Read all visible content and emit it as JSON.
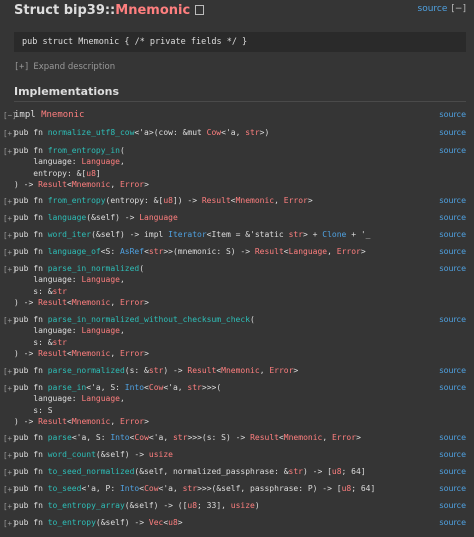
{
  "header": {
    "prefix": "Struct ",
    "crate": "bip39::",
    "name": "Mnemonic"
  },
  "top_source": {
    "label": "source",
    "collapse": "[−]"
  },
  "declaration": "pub struct Mnemonic { /* private fields */ }",
  "expand": {
    "toggle": "[+]",
    "label": "Expand description"
  },
  "implementations_heading": "Implementations",
  "source_label": "source",
  "items": [
    {
      "id": "impl",
      "toggle": "[−]",
      "lines": [
        [
          [
            "impl ",
            "p"
          ],
          [
            "Mnemonic",
            "ty"
          ]
        ]
      ]
    },
    {
      "id": "normalize_utf8_cow",
      "toggle": "[+]",
      "lines": [
        [
          [
            "pub fn ",
            "p"
          ],
          [
            "normalize_utf8_cow",
            "fn"
          ],
          [
            "<'a>(cow: &mut ",
            "p"
          ],
          [
            "Cow",
            "ty"
          ],
          [
            "<'a, ",
            "p"
          ],
          [
            "str",
            "ty"
          ],
          [
            ">)",
            "p"
          ]
        ]
      ]
    },
    {
      "id": "from_entropy_in",
      "toggle": "[+]",
      "lines": [
        [
          [
            "pub fn ",
            "p"
          ],
          [
            "from_entropy_in",
            "fn"
          ],
          [
            "(",
            "p"
          ]
        ],
        [
          [
            "    language: ",
            "p"
          ],
          [
            "Language",
            "ty"
          ],
          [
            ",",
            "p"
          ]
        ],
        [
          [
            "    entropy: &[",
            "p"
          ],
          [
            "u8",
            "ty"
          ],
          [
            "]",
            "p"
          ]
        ],
        [
          [
            ") -> ",
            "p"
          ],
          [
            "Result",
            "ty"
          ],
          [
            "<",
            "p"
          ],
          [
            "Mnemonic",
            "ty"
          ],
          [
            ", ",
            "p"
          ],
          [
            "Error",
            "ty"
          ],
          [
            ">",
            "p"
          ]
        ]
      ]
    },
    {
      "id": "from_entropy",
      "toggle": "[+]",
      "lines": [
        [
          [
            "pub fn ",
            "p"
          ],
          [
            "from_entropy",
            "fn"
          ],
          [
            "(entropy: &[",
            "p"
          ],
          [
            "u8",
            "ty"
          ],
          [
            "]) -> ",
            "p"
          ],
          [
            "Result",
            "ty"
          ],
          [
            "<",
            "p"
          ],
          [
            "Mnemonic",
            "ty"
          ],
          [
            ", ",
            "p"
          ],
          [
            "Error",
            "ty"
          ],
          [
            ">",
            "p"
          ]
        ]
      ]
    },
    {
      "id": "language",
      "toggle": "[+]",
      "lines": [
        [
          [
            "pub fn ",
            "p"
          ],
          [
            "language",
            "fn"
          ],
          [
            "(&self) -> ",
            "p"
          ],
          [
            "Language",
            "ty"
          ]
        ]
      ]
    },
    {
      "id": "word_iter",
      "toggle": "[+]",
      "lines": [
        [
          [
            "pub fn ",
            "p"
          ],
          [
            "word_iter",
            "fn"
          ],
          [
            "(&self) -> impl ",
            "p"
          ],
          [
            "Iterator",
            "tr"
          ],
          [
            "<Item = &'static ",
            "p"
          ],
          [
            "str",
            "ty"
          ],
          [
            "> + ",
            "p"
          ],
          [
            "Clone",
            "tr"
          ],
          [
            " + '_",
            "p"
          ]
        ]
      ]
    },
    {
      "id": "language_of",
      "toggle": "[+]",
      "lines": [
        [
          [
            "pub fn ",
            "p"
          ],
          [
            "language_of",
            "fn"
          ],
          [
            "<S: ",
            "p"
          ],
          [
            "AsRef",
            "tr"
          ],
          [
            "<",
            "p"
          ],
          [
            "str",
            "ty"
          ],
          [
            ">>(mnemonic: S) -> ",
            "p"
          ],
          [
            "Result",
            "ty"
          ],
          [
            "<",
            "p"
          ],
          [
            "Language",
            "ty"
          ],
          [
            ", ",
            "p"
          ],
          [
            "Error",
            "ty"
          ],
          [
            ">",
            "p"
          ]
        ]
      ]
    },
    {
      "id": "parse_in_normalized",
      "toggle": "[+]",
      "lines": [
        [
          [
            "pub fn ",
            "p"
          ],
          [
            "parse_in_normalized",
            "fn"
          ],
          [
            "(",
            "p"
          ]
        ],
        [
          [
            "    language: ",
            "p"
          ],
          [
            "Language",
            "ty"
          ],
          [
            ",",
            "p"
          ]
        ],
        [
          [
            "    s: &",
            "p"
          ],
          [
            "str",
            "ty"
          ]
        ],
        [
          [
            ") -> ",
            "p"
          ],
          [
            "Result",
            "ty"
          ],
          [
            "<",
            "p"
          ],
          [
            "Mnemonic",
            "ty"
          ],
          [
            ", ",
            "p"
          ],
          [
            "Error",
            "ty"
          ],
          [
            ">",
            "p"
          ]
        ]
      ]
    },
    {
      "id": "parse_in_normalized_without_checksum_check",
      "toggle": "[+]",
      "lines": [
        [
          [
            "pub fn ",
            "p"
          ],
          [
            "parse_in_normalized_without_checksum_check",
            "fn"
          ],
          [
            "(",
            "p"
          ]
        ],
        [
          [
            "    language: ",
            "p"
          ],
          [
            "Language",
            "ty"
          ],
          [
            ",",
            "p"
          ]
        ],
        [
          [
            "    s: &",
            "p"
          ],
          [
            "str",
            "ty"
          ]
        ],
        [
          [
            ") -> ",
            "p"
          ],
          [
            "Result",
            "ty"
          ],
          [
            "<",
            "p"
          ],
          [
            "Mnemonic",
            "ty"
          ],
          [
            ", ",
            "p"
          ],
          [
            "Error",
            "ty"
          ],
          [
            ">",
            "p"
          ]
        ]
      ]
    },
    {
      "id": "parse_normalized",
      "toggle": "[+]",
      "lines": [
        [
          [
            "pub fn ",
            "p"
          ],
          [
            "parse_normalized",
            "fn"
          ],
          [
            "(s: &",
            "p"
          ],
          [
            "str",
            "ty"
          ],
          [
            ") -> ",
            "p"
          ],
          [
            "Result",
            "ty"
          ],
          [
            "<",
            "p"
          ],
          [
            "Mnemonic",
            "ty"
          ],
          [
            ", ",
            "p"
          ],
          [
            "Error",
            "ty"
          ],
          [
            ">",
            "p"
          ]
        ]
      ]
    },
    {
      "id": "parse_in",
      "toggle": "[+]",
      "lines": [
        [
          [
            "pub fn ",
            "p"
          ],
          [
            "parse_in",
            "fn"
          ],
          [
            "<'a, S: ",
            "p"
          ],
          [
            "Into",
            "tr"
          ],
          [
            "<",
            "p"
          ],
          [
            "Cow",
            "ty"
          ],
          [
            "<'a, ",
            "p"
          ],
          [
            "str",
            "ty"
          ],
          [
            ">>>(",
            "p"
          ]
        ],
        [
          [
            "    language: ",
            "p"
          ],
          [
            "Language",
            "ty"
          ],
          [
            ",",
            "p"
          ]
        ],
        [
          [
            "    s: S",
            "p"
          ]
        ],
        [
          [
            ") -> ",
            "p"
          ],
          [
            "Result",
            "ty"
          ],
          [
            "<",
            "p"
          ],
          [
            "Mnemonic",
            "ty"
          ],
          [
            ", ",
            "p"
          ],
          [
            "Error",
            "ty"
          ],
          [
            ">",
            "p"
          ]
        ]
      ]
    },
    {
      "id": "parse",
      "toggle": "[+]",
      "lines": [
        [
          [
            "pub fn ",
            "p"
          ],
          [
            "parse",
            "fn"
          ],
          [
            "<'a, S: ",
            "p"
          ],
          [
            "Into",
            "tr"
          ],
          [
            "<",
            "p"
          ],
          [
            "Cow",
            "ty"
          ],
          [
            "<'a, ",
            "p"
          ],
          [
            "str",
            "ty"
          ],
          [
            ">>>(s: S) -> ",
            "p"
          ],
          [
            "Result",
            "ty"
          ],
          [
            "<",
            "p"
          ],
          [
            "Mnemonic",
            "ty"
          ],
          [
            ", ",
            "p"
          ],
          [
            "Error",
            "ty"
          ],
          [
            ">",
            "p"
          ]
        ]
      ]
    },
    {
      "id": "word_count",
      "toggle": "[+]",
      "lines": [
        [
          [
            "pub fn ",
            "p"
          ],
          [
            "word_count",
            "fn"
          ],
          [
            "(&self) -> ",
            "p"
          ],
          [
            "usize",
            "ty"
          ]
        ]
      ]
    },
    {
      "id": "to_seed_normalized",
      "toggle": "[+]",
      "lines": [
        [
          [
            "pub fn ",
            "p"
          ],
          [
            "to_seed_normalized",
            "fn"
          ],
          [
            "(&self, normalized_passphrase: &",
            "p"
          ],
          [
            "str",
            "ty"
          ],
          [
            ") -> [",
            "p"
          ],
          [
            "u8",
            "ty"
          ],
          [
            "; 64]",
            "p"
          ]
        ]
      ]
    },
    {
      "id": "to_seed",
      "toggle": "[+]",
      "lines": [
        [
          [
            "pub fn ",
            "p"
          ],
          [
            "to_seed",
            "fn"
          ],
          [
            "<'a, P: ",
            "p"
          ],
          [
            "Into",
            "tr"
          ],
          [
            "<",
            "p"
          ],
          [
            "Cow",
            "ty"
          ],
          [
            "<'a, ",
            "p"
          ],
          [
            "str",
            "ty"
          ],
          [
            ">>>(&self, passphrase: P) -> [",
            "p"
          ],
          [
            "u8",
            "ty"
          ],
          [
            "; 64]",
            "p"
          ]
        ]
      ]
    },
    {
      "id": "to_entropy_array",
      "toggle": "[+]",
      "lines": [
        [
          [
            "pub fn ",
            "p"
          ],
          [
            "to_entropy_array",
            "fn"
          ],
          [
            "(&self) -> ([",
            "p"
          ],
          [
            "u8",
            "ty"
          ],
          [
            "; 33], ",
            "p"
          ],
          [
            "usize",
            "ty"
          ],
          [
            ")",
            "p"
          ]
        ]
      ]
    },
    {
      "id": "to_entropy",
      "toggle": "[+]",
      "lines": [
        [
          [
            "pub fn ",
            "p"
          ],
          [
            "to_entropy",
            "fn"
          ],
          [
            "(&self) -> ",
            "p"
          ],
          [
            "Vec",
            "ty"
          ],
          [
            "<",
            "p"
          ],
          [
            "u8",
            "ty"
          ],
          [
            ">",
            "p"
          ]
        ]
      ]
    }
  ]
}
